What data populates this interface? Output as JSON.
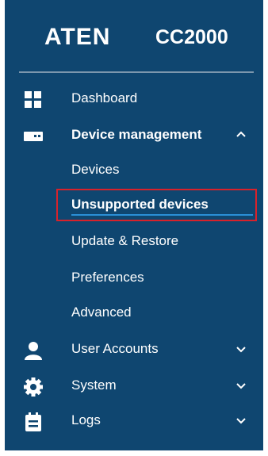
{
  "brand": {
    "logo": "ATEN",
    "model": "CC2000"
  },
  "nav": {
    "dashboard": {
      "label": "Dashboard",
      "icon": "grid-icon"
    },
    "device_management": {
      "label": "Device management",
      "icon": "device-icon",
      "expanded": true,
      "children": [
        {
          "label": "Devices"
        },
        {
          "label": "Unsupported devices",
          "active": true
        },
        {
          "label": "Update & Restore"
        },
        {
          "label": "Preferences"
        },
        {
          "label": "Advanced"
        }
      ]
    },
    "user_accounts": {
      "label": "User Accounts",
      "icon": "user-icon",
      "expanded": false
    },
    "system": {
      "label": "System",
      "icon": "gear-icon",
      "expanded": false
    },
    "logs": {
      "label": "Logs",
      "icon": "clipboard-icon",
      "expanded": false
    }
  },
  "colors": {
    "sidebar_bg": "#0f4670",
    "text": "#ffffff",
    "highlight_border": "#d8222b",
    "active_underline": "#2b8fd6"
  }
}
